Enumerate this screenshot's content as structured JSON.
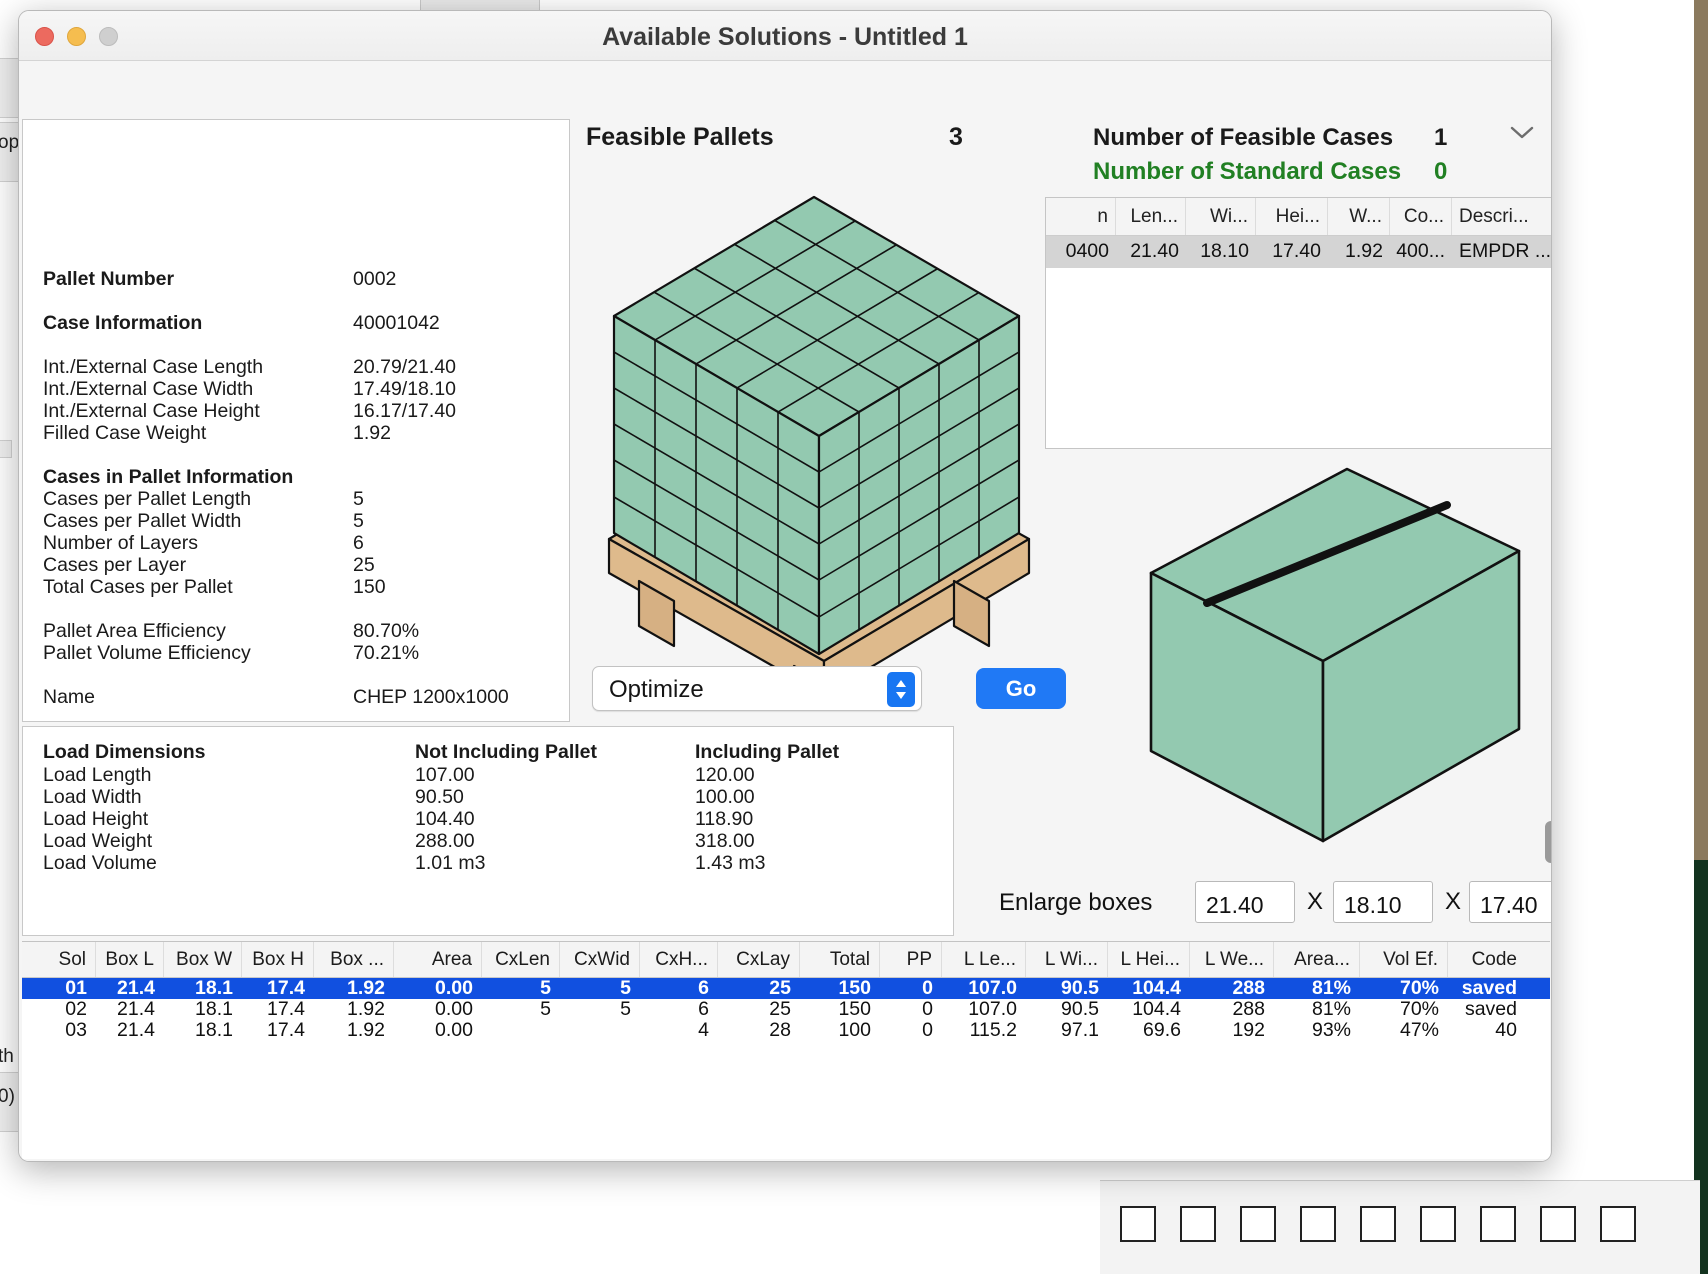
{
  "window": {
    "title": "Available Solutions - Untitled 1",
    "traffic_lights": [
      "close",
      "minimize",
      "zoom"
    ]
  },
  "background": {
    "left_fragment": "op",
    "left_fragment2": "th",
    "bottom_fragment": "0)"
  },
  "pallet_info": {
    "rows": [
      {
        "label": "Pallet Number",
        "value": "0002",
        "bold": true
      },
      {
        "label": "Case Information",
        "value": "40001042",
        "bold": true
      },
      {
        "label": "Int./External Case Length",
        "value": "20.79/21.40",
        "bold": false
      },
      {
        "label": "Int./External Case Width",
        "value": "17.49/18.10",
        "bold": false
      },
      {
        "label": "Int./External Case Height",
        "value": "16.17/17.40",
        "bold": false
      },
      {
        "label": "Filled Case Weight",
        "value": "1.92",
        "bold": false
      },
      {
        "label": "Cases in Pallet Information",
        "value": "",
        "bold": true
      },
      {
        "label": "Cases per Pallet Length",
        "value": "5",
        "bold": false
      },
      {
        "label": "Cases per Pallet Width",
        "value": "5",
        "bold": false
      },
      {
        "label": "Number of Layers",
        "value": "6",
        "bold": false
      },
      {
        "label": "Cases per Layer",
        "value": "25",
        "bold": false
      },
      {
        "label": "Total Cases per Pallet",
        "value": "150",
        "bold": false
      },
      {
        "label": "Pallet Area Efficiency",
        "value": "80.70%",
        "bold": false
      },
      {
        "label": "Pallet Volume Efficiency",
        "value": "70.21%",
        "bold": false
      },
      {
        "label": "Name",
        "value": "CHEP 1200x1000",
        "bold": false
      }
    ]
  },
  "middle": {
    "feasible_pallets_label": "Feasible Pallets",
    "feasible_pallets_value": "3",
    "optimize_label": "Optimize",
    "go_label": "Go",
    "pallet_icon": "pallet-3d-icon"
  },
  "right": {
    "feasible_cases_label": "Number of Feasible Cases",
    "feasible_cases_value": "1",
    "standard_cases_label": "Number of Standard Cases",
    "standard_cases_value": "0",
    "standard_cases_color": "#218023",
    "disclosure_icon": "chevron-down-icon",
    "box_icon": "box-3d-icon",
    "case_table": {
      "columns": [
        "n",
        "Len...",
        "Wi...",
        "Hei...",
        "W...",
        "Co...",
        "Descri..."
      ],
      "rows": [
        [
          "0400",
          "21.40",
          "18.10",
          "17.40",
          "1.92",
          "400...",
          "EMPDR ..."
        ]
      ]
    },
    "enlarge": {
      "label": "Enlarge boxes",
      "length": "21.40",
      "width": "18.10",
      "height": "17.40",
      "separator": "X"
    }
  },
  "load_dimensions": {
    "header": [
      "Load Dimensions",
      "Not Including Pallet",
      "Including Pallet"
    ],
    "rows": [
      [
        "Load Length",
        "107.00",
        "120.00"
      ],
      [
        "Load Width",
        "90.50",
        "100.00"
      ],
      [
        "Load Height",
        "104.40",
        "118.90"
      ],
      [
        "Load Weight",
        "288.00",
        "318.00"
      ],
      [
        "Load Volume",
        "1.01 m3",
        "1.43 m3"
      ]
    ]
  },
  "solutions_table": {
    "columns": [
      "Sol",
      "Box L",
      "Box W",
      "Box H",
      "Box ...",
      "Area",
      "CxLen",
      "CxWid",
      "CxH...",
      "CxLay",
      "Total",
      "PP",
      "L Le...",
      "L Wi...",
      "L Hei...",
      "L We...",
      "Area...",
      "Vol Ef.",
      "Code"
    ],
    "rows": [
      {
        "selected": true,
        "cells": [
          "01",
          "21.4",
          "18.1",
          "17.4",
          "1.92",
          "0.00",
          "5",
          "5",
          "6",
          "25",
          "150",
          "0",
          "107.0",
          "90.5",
          "104.4",
          "288",
          "81%",
          "70%",
          "saved"
        ]
      },
      {
        "selected": false,
        "cells": [
          "02",
          "21.4",
          "18.1",
          "17.4",
          "1.92",
          "0.00",
          "5",
          "5",
          "6",
          "25",
          "150",
          "0",
          "107.0",
          "90.5",
          "104.4",
          "288",
          "81%",
          "70%",
          "saved"
        ]
      },
      {
        "selected": false,
        "cells": [
          "03",
          "21.4",
          "18.1",
          "17.4",
          "1.92",
          "0.00",
          "",
          "",
          "4",
          "28",
          "100",
          "0",
          "115.2",
          "97.1",
          "69.6",
          "192",
          "93%",
          "47%",
          "40"
        ]
      }
    ]
  },
  "colors": {
    "accent_blue": "#2079f5",
    "selection_blue": "#1150e0",
    "green": "#218023",
    "case_green": "#93c9b0",
    "pallet_wood": "#deba8c"
  }
}
